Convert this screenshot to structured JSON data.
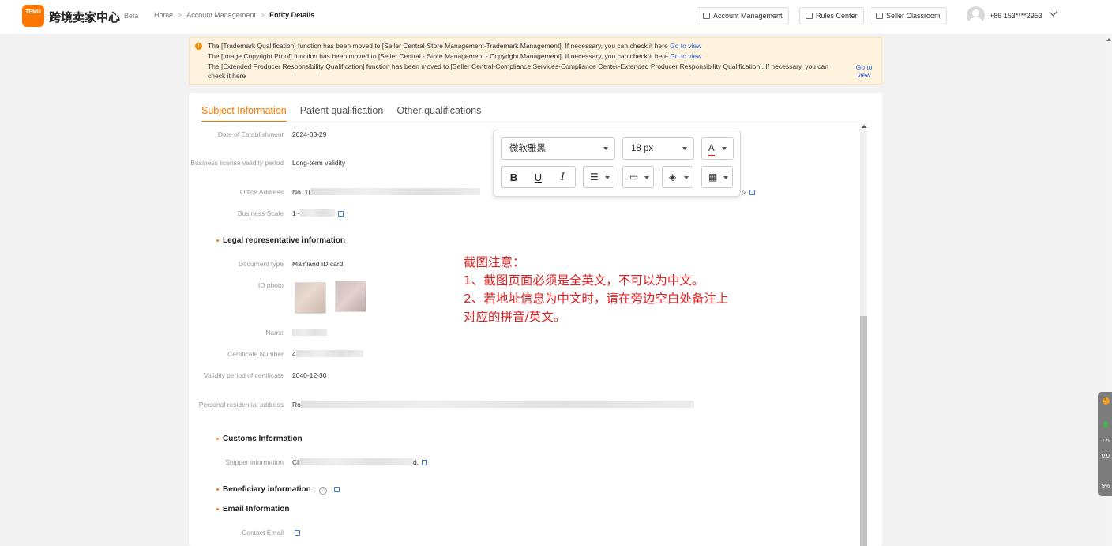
{
  "header": {
    "logo_text": "TEMU",
    "brand": "跨境卖家中心",
    "beta": "Beta",
    "breadcrumb": [
      "Home",
      "Account Management",
      "Entity Details"
    ],
    "buttons": [
      "Account Management",
      "Rules Center",
      "Seller Classroom"
    ],
    "phone": "+86 153****2953"
  },
  "notice": {
    "line1": "The [Trademark Qualification] function has been moved to [Seller Central-Store Management-Trademark Management]. If necessary, you can check it here",
    "line2": "The [Image Copyright Proof] function has been moved to [Seller Central - Store Management - Copyright Management]. If necessary, you can check it here",
    "line3": "The [Extended Producer Responsibility Qualification] function has been moved to [Seller Central-Compliance Services-Compliance Center-Extended Producer Responsibility Qualification]. If necessary, you can check it here",
    "link": "Go to view"
  },
  "tabs": [
    "Subject Information",
    "Patent qualification",
    "Other qualifications"
  ],
  "fields": {
    "date_est_label": "Date of Establishment",
    "date_est_value": "2024-03-29",
    "license_label": "Business license validity period",
    "license_value": "Long-term validity",
    "office_label": "Office Address",
    "office_value_start": "No. 1(",
    "office_value_end": "02",
    "scale_label": "Business Scale",
    "scale_value": "1~"
  },
  "legal": {
    "title": "Legal representative information",
    "doc_type_label": "Document type",
    "doc_type_value": "Mainland ID card",
    "id_photo_label": "ID photo",
    "name_label": "Name",
    "cert_label": "Certificate Number",
    "cert_value": "4",
    "validity_label": "Validity period of certificate",
    "validity_value": "2040-12-30",
    "address_label": "Personal residential address",
    "address_value": "Ro"
  },
  "customs": {
    "title": "Customs Information",
    "shipper_label": "Shipper information",
    "shipper_value_start": "Cl",
    "shipper_value_end": "d."
  },
  "beneficiary": {
    "title": "Beneficiary information",
    "help": "?"
  },
  "email": {
    "title": "Email Information",
    "contact_label": "Contact Email"
  },
  "toolbar": {
    "font": "微软雅黑",
    "size": "18 px",
    "color_glyph": "A",
    "bold": "B",
    "underline": "U",
    "italic": "I"
  },
  "annotation": {
    "line1": "截图注意：",
    "line2": "1、截图页面必须是全英文，不可以为中文。",
    "line3": "2、若地址信息为中文时，请在旁边空白处备注上",
    "line4": "对应的拼音/英文。"
  },
  "widget": {
    "badge": "1",
    "v1": "1.5",
    "v2": "0.0",
    "v3": "9%"
  },
  "colors": {
    "accent": "#fb7701",
    "link": "#2a66d9",
    "annotation": "#e02020"
  }
}
